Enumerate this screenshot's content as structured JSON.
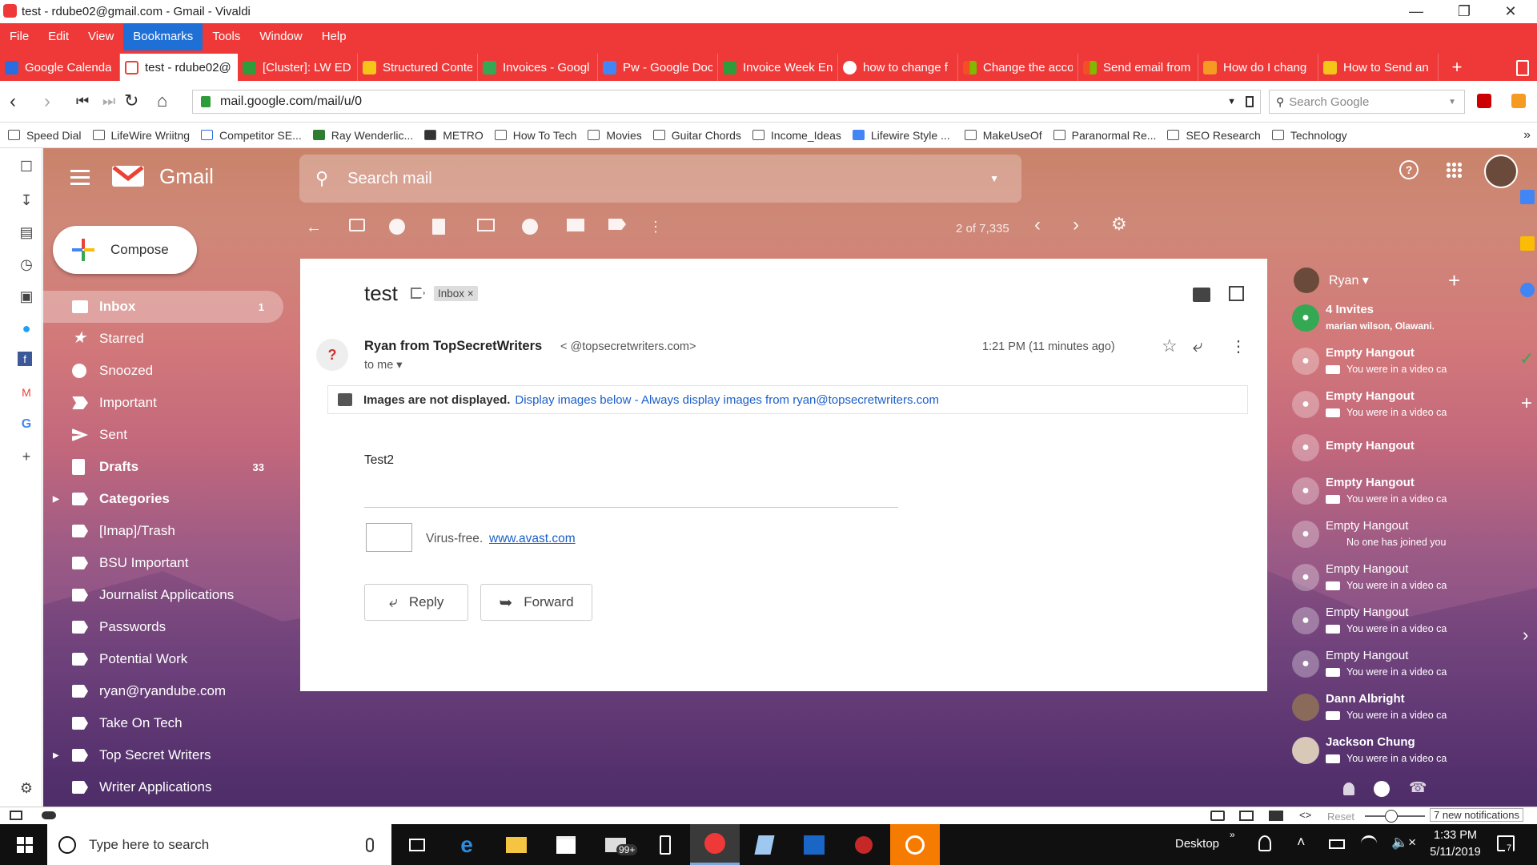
{
  "window": {
    "title": "test - rdube02@gmail.com - Gmail - Vivaldi"
  },
  "menu": [
    "File",
    "Edit",
    "View",
    "Bookmarks",
    "Tools",
    "Window",
    "Help"
  ],
  "tabs": [
    {
      "label": "Google Calenda",
      "color": "#2a6de0"
    },
    {
      "label": "test - rdube02@",
      "color": "#ea4335"
    },
    {
      "label": "[Cluster]: LW ED",
      "color": "#2e9c3a"
    },
    {
      "label": "Structured Conte",
      "color": "#f5c518"
    },
    {
      "label": "Invoices - Googl",
      "color": "#34a853"
    },
    {
      "label": "Pw - Google Doc",
      "color": "#4285f4"
    },
    {
      "label": "Invoice Week En",
      "color": "#2e9c3a"
    },
    {
      "label": "how to change f",
      "color": "#ffffff"
    },
    {
      "label": "Change the acco",
      "color": "#f25022"
    },
    {
      "label": "Send email from",
      "color": "#f25022"
    },
    {
      "label": "How do I chang",
      "color": "#f59b21"
    },
    {
      "label": "How to Send an",
      "color": "#f5c518"
    }
  ],
  "address": {
    "url": "mail.google.com/mail/u/0",
    "search_placeholder": "Search Google"
  },
  "bookmarks": [
    "Speed Dial",
    "LifeWire Wriitng",
    "Competitor SE...",
    "Ray Wenderlic...",
    "METRO",
    "How To Tech",
    "Movies",
    "Guitar Chords",
    "Income_Ideas",
    "Lifewire Style ...",
    "MakeUseOf",
    "Paranormal Re...",
    "SEO Research",
    "Technology"
  ],
  "gmail": {
    "brand": "Gmail",
    "search_placeholder": "Search mail",
    "compose": "Compose",
    "nav": [
      {
        "label": "Inbox",
        "count": "1"
      },
      {
        "label": "Starred",
        "count": ""
      },
      {
        "label": "Snoozed",
        "count": ""
      },
      {
        "label": "Important",
        "count": ""
      },
      {
        "label": "Sent",
        "count": ""
      },
      {
        "label": "Drafts",
        "count": "33"
      },
      {
        "label": "Categories",
        "count": ""
      },
      {
        "label": "[Imap]/Trash",
        "count": ""
      },
      {
        "label": "BSU Important",
        "count": ""
      },
      {
        "label": "Journalist Applications",
        "count": ""
      },
      {
        "label": "Passwords",
        "count": ""
      },
      {
        "label": "Potential Work",
        "count": ""
      },
      {
        "label": "ryan@ryandube.com",
        "count": ""
      },
      {
        "label": "Take On Tech",
        "count": ""
      },
      {
        "label": "Top Secret Writers",
        "count": ""
      },
      {
        "label": "Writer Applications",
        "count": ""
      }
    ],
    "pager": "2 of 7,335",
    "message": {
      "subject": "test",
      "label": "Inbox",
      "sender": "Ryan from TopSecretWriters",
      "email": "< @topsecretwriters.com>",
      "to": "to me",
      "time": "1:21 PM (11 minutes ago)",
      "notice_bold": "Images are not displayed.",
      "notice_link": "Display images below - Always display images from ryan@topsecretwriters.com",
      "body": "Test2",
      "virus": "Virus-free.",
      "virus_link": "www.avast.com",
      "reply": "Reply",
      "forward": "Forward"
    },
    "hangouts": {
      "user": "Ryan",
      "items": [
        {
          "name": "4 Invites",
          "sub": "marian wilson, Olawani..."
        },
        {
          "name": "Empty Hangout",
          "sub": "You were in a video ca"
        },
        {
          "name": "Empty Hangout",
          "sub": "You were in a video ca"
        },
        {
          "name": "Empty Hangout",
          "sub": ""
        },
        {
          "name": "Empty Hangout",
          "sub": "You were in a video ca"
        },
        {
          "name": "Empty Hangout",
          "sub": "No one has joined you"
        },
        {
          "name": "Empty Hangout",
          "sub": "You were in a video ca"
        },
        {
          "name": "Empty Hangout",
          "sub": "You were in a video ca"
        },
        {
          "name": "Empty Hangout",
          "sub": "You were in a video ca"
        },
        {
          "name": "Dann Albright",
          "sub": "You were in a video ca"
        },
        {
          "name": "Jackson Chung",
          "sub": "You were in a video ca"
        }
      ]
    }
  },
  "status": {
    "reset": "Reset",
    "notifications": "7 new notifications"
  },
  "taskbar": {
    "search": "Type here to search",
    "desktop": "Desktop",
    "time": "1:33 PM",
    "date": "5/11/2019",
    "badge": "99+",
    "notif": "7"
  }
}
